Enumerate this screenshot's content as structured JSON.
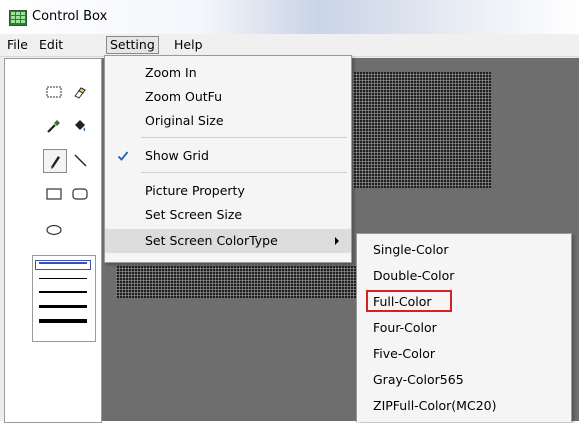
{
  "window": {
    "title": "Control Box",
    "title_icon": "app-grid-icon"
  },
  "menubar": {
    "items": [
      "File",
      "Edit",
      "Setting",
      "Help"
    ],
    "active_item": "Setting"
  },
  "setting_menu": {
    "items": [
      {
        "label": "Zoom In"
      },
      {
        "label": "Zoom OutFu"
      },
      {
        "label": "Original Size"
      },
      {
        "label": "Show Grid",
        "checked": true
      },
      {
        "label": "Picture Property"
      },
      {
        "label": "Set Screen Size"
      },
      {
        "label": "Set Screen ColorType",
        "submenu": true,
        "highlighted": true
      }
    ]
  },
  "colortype_submenu": {
    "items": [
      "Single-Color",
      "Double-Color",
      "Full-Color",
      "Four-Color",
      "Five-Color",
      "Gray-Color565",
      "ZIPFull-Color(MC20)"
    ],
    "outlined_item": "Full-Color",
    "outline_color": "#d82020"
  },
  "toolbox": {
    "tools": [
      "rectangle-select-icon",
      "eraser-icon",
      "eyedropper-icon",
      "fill-bucket-icon",
      "pencil-icon",
      "line-icon",
      "rectangle-icon",
      "rounded-rectangle-icon",
      "ellipse-icon"
    ],
    "selected_tool": "pencil-icon",
    "line_widths": [
      "1",
      "2",
      "3",
      "4",
      "5"
    ],
    "selected_line_width": "1"
  },
  "colors": {
    "selection_blue": "#3a4fb5",
    "canvas_bg": "#6e6e6e",
    "grid_dark": "#1e1e1e"
  }
}
